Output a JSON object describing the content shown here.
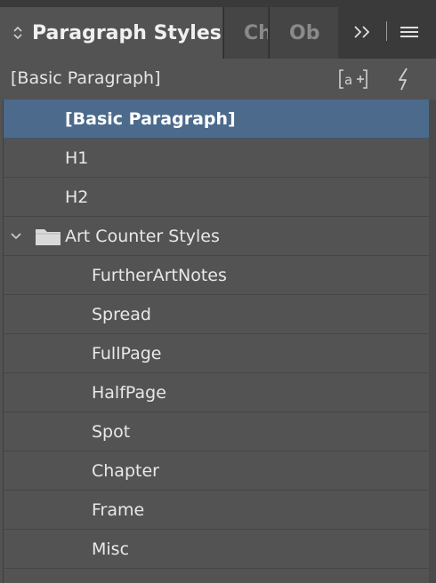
{
  "tabs": {
    "active_label": "Paragraph Styles",
    "inactive": [
      "Ch",
      "Ob"
    ]
  },
  "header": {
    "current_style": "[Basic Paragraph]"
  },
  "styles": {
    "basic": "[Basic Paragraph]",
    "h1": "H1",
    "h2": "H2",
    "group": {
      "label": "Art Counter Styles",
      "children": [
        "FurtherArtNotes",
        "Spread",
        "FullPage",
        "HalfPage",
        "Spot",
        "Chapter",
        "Frame",
        "Misc"
      ]
    }
  },
  "colors": {
    "panel_bg": "#535353",
    "tabbar_bg": "#3a3a3a",
    "selection": "#4c6a8c",
    "text": "#e8e8e8"
  },
  "icons": {
    "tab_chevron": "updown-chevron-icon",
    "overflow": "double-chevron-right-icon",
    "menu": "hamburger-menu-icon",
    "new_style": "create-new-style-icon",
    "quick_apply": "lightning-bolt-icon",
    "group_toggle": "chevron-down-icon",
    "group_folder": "folder-icon"
  }
}
